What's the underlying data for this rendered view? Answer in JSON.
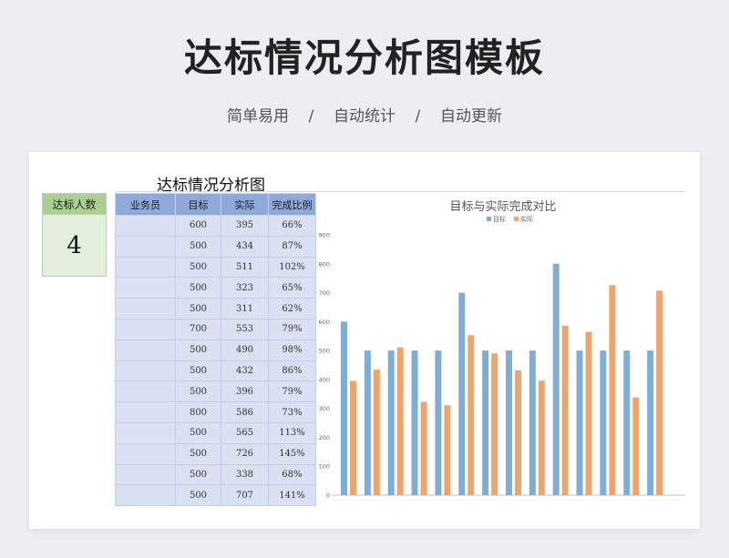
{
  "page": {
    "title": "达标情况分析图模板",
    "subtitle_items": [
      "简单易用",
      "自动统计",
      "自动更新"
    ],
    "subtitle_separator": "/"
  },
  "sheet": {
    "title": "达标情况分析图",
    "count_label": "达标人数",
    "count_value": "4",
    "table": {
      "headers": [
        "业务员",
        "目标",
        "实际",
        "完成比例"
      ],
      "rows": [
        [
          "",
          "600",
          "395",
          "66%"
        ],
        [
          "",
          "500",
          "434",
          "87%"
        ],
        [
          "",
          "500",
          "511",
          "102%"
        ],
        [
          "",
          "500",
          "323",
          "65%"
        ],
        [
          "",
          "500",
          "311",
          "62%"
        ],
        [
          "",
          "700",
          "553",
          "79%"
        ],
        [
          "",
          "500",
          "490",
          "98%"
        ],
        [
          "",
          "500",
          "432",
          "86%"
        ],
        [
          "",
          "500",
          "396",
          "79%"
        ],
        [
          "",
          "800",
          "586",
          "73%"
        ],
        [
          "",
          "500",
          "565",
          "113%"
        ],
        [
          "",
          "500",
          "726",
          "145%"
        ],
        [
          "",
          "500",
          "338",
          "68%"
        ],
        [
          "",
          "500",
          "707",
          "141%"
        ]
      ]
    }
  },
  "chart_data": {
    "type": "bar",
    "title": "目标与实际完成对比",
    "xlabel": "",
    "ylabel": "",
    "ylim": [
      0,
      900
    ],
    "yticks": [
      0,
      100,
      200,
      300,
      400,
      500,
      600,
      700,
      800,
      900
    ],
    "legend_position": "top",
    "grid": false,
    "series": [
      {
        "name": "目标",
        "color": "#7eaed6",
        "values": [
          600,
          500,
          500,
          500,
          500,
          700,
          500,
          500,
          500,
          800,
          500,
          500,
          500,
          500
        ]
      },
      {
        "name": "实际",
        "color": "#efa46e",
        "values": [
          395,
          434,
          511,
          323,
          311,
          553,
          490,
          432,
          396,
          586,
          565,
          726,
          338,
          707
        ]
      }
    ]
  }
}
